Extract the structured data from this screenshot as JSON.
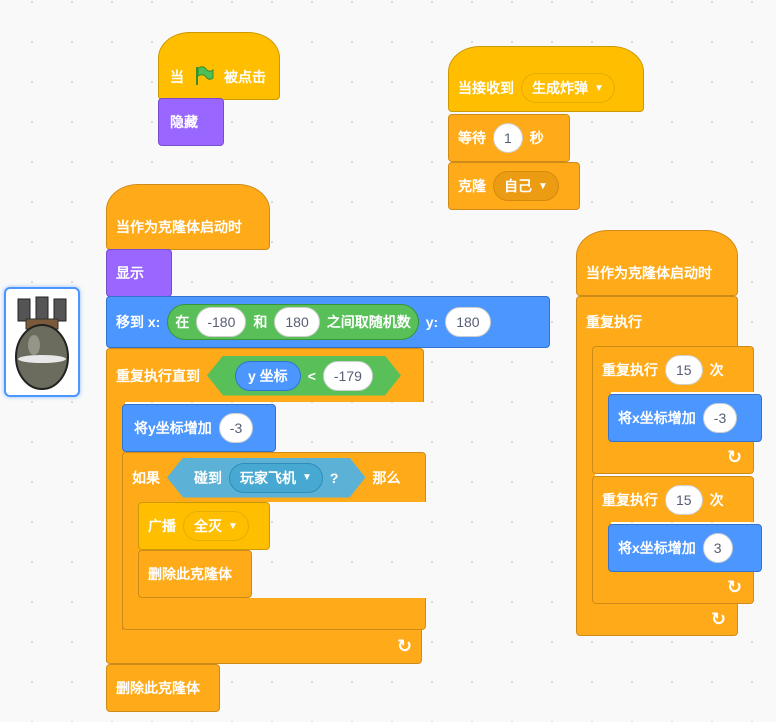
{
  "sprite": {
    "name": "bomb"
  },
  "script1": {
    "hat_when": "当",
    "hat_clicked": "被点击",
    "hide": "隐藏"
  },
  "script2": {
    "hat": "当接收到",
    "message": "生成炸弹",
    "wait": "等待",
    "wait_value": "1",
    "seconds": "秒",
    "clone": "克隆",
    "clone_target": "自己"
  },
  "script3": {
    "hat": "当作为克隆体启动时",
    "show": "显示",
    "goto": "移到 x:",
    "goto_in": "在",
    "rand_from": "-180",
    "rand_and": "和",
    "rand_to": "180",
    "rand_between": "之间取随机数",
    "goto_y": "y:",
    "goto_y_value": "180",
    "repeat_until": "重复执行直到",
    "y_reporter": "y 坐标",
    "lt": "<",
    "lt_value": "-179",
    "change_y": "将y坐标增加",
    "change_y_value": "-3",
    "if": "如果",
    "touching": "碰到",
    "touch_target": "玩家飞机",
    "question": "?",
    "then": "那么",
    "broadcast": "广播",
    "broadcast_msg": "全灭",
    "delete_clone_inner": "删除此克隆体",
    "delete_clone": "删除此克隆体"
  },
  "script4": {
    "hat": "当作为克隆体启动时",
    "forever": "重复执行",
    "repeat1": "重复执行",
    "repeat1_times": "15",
    "repeat1_unit": "次",
    "change_x1": "将x坐标增加",
    "change_x1_value": "-3",
    "repeat2": "重复执行",
    "repeat2_times": "15",
    "repeat2_unit": "次",
    "change_x2": "将x坐标增加",
    "change_x2_value": "3"
  },
  "colors": {
    "events": "#ffbf00",
    "control": "#ffab19",
    "looks": "#9966ff",
    "motion": "#4c97ff",
    "operators": "#59c059",
    "sensing": "#5cb1d6"
  }
}
